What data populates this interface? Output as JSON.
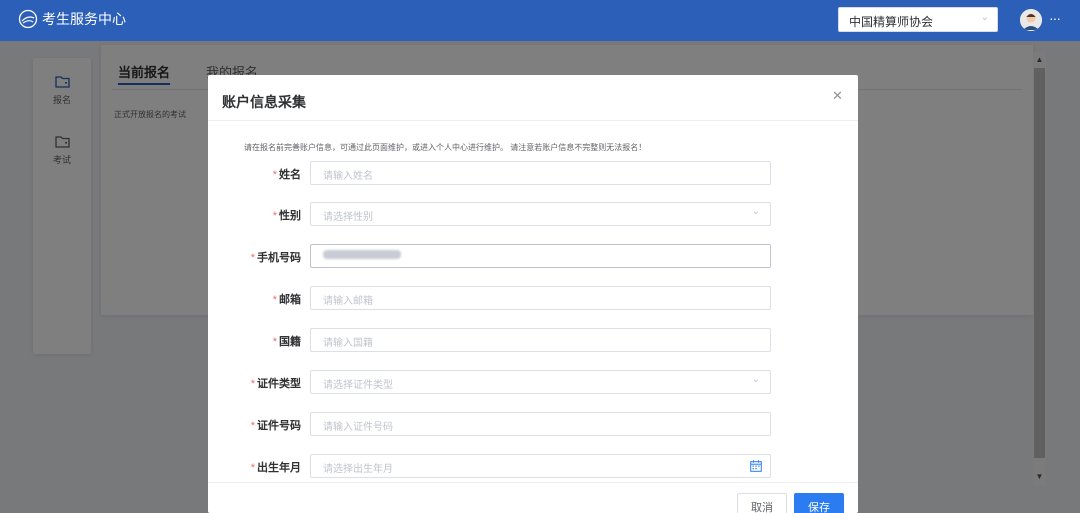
{
  "header": {
    "app_title": "考生服务中心",
    "org_select": "中国精算师协会",
    "more_icon": "ellipsis-icon"
  },
  "sidebar": {
    "items": [
      {
        "label": "报名",
        "icon": "folder-icon"
      },
      {
        "label": "考试",
        "icon": "folder-icon"
      }
    ]
  },
  "main": {
    "tabs": [
      {
        "label": "当前报名",
        "active": true
      },
      {
        "label": "我的报名",
        "active": false
      }
    ],
    "section_text": "正式开放报名的考试"
  },
  "dialog": {
    "title": "账户信息采集",
    "close_icon": "close-icon",
    "notice": "请在报名前完善账户信息，可通过此页面维护，或进入个人中心进行维护。 请注意若账户信息不完整则无法报名！",
    "fields": [
      {
        "label": "姓名",
        "required": true,
        "placeholder": "请输入姓名",
        "value": ""
      },
      {
        "label": "性别",
        "required": true,
        "placeholder": "请选择性别",
        "value": "",
        "type": "select"
      },
      {
        "label": "手机号码",
        "required": true,
        "placeholder": "",
        "value": "",
        "masked": true
      },
      {
        "label": "邮箱",
        "required": true,
        "placeholder": "请输入邮箱",
        "value": ""
      },
      {
        "label": "国籍",
        "required": true,
        "placeholder": "请输入国籍",
        "value": ""
      },
      {
        "label": "证件类型",
        "required": true,
        "placeholder": "请选择证件类型",
        "value": "",
        "type": "select"
      },
      {
        "label": "证件号码",
        "required": true,
        "placeholder": "请输入证件号码",
        "value": ""
      },
      {
        "label": "出生年月",
        "required": true,
        "placeholder": "请选择出生年月",
        "value": "",
        "type": "date"
      }
    ],
    "buttons": {
      "cancel": "取消",
      "save": "保存"
    }
  },
  "colors": {
    "brand": "#2b5fb8",
    "primary_button": "#2b7cf0",
    "required": "#f56c6c"
  }
}
